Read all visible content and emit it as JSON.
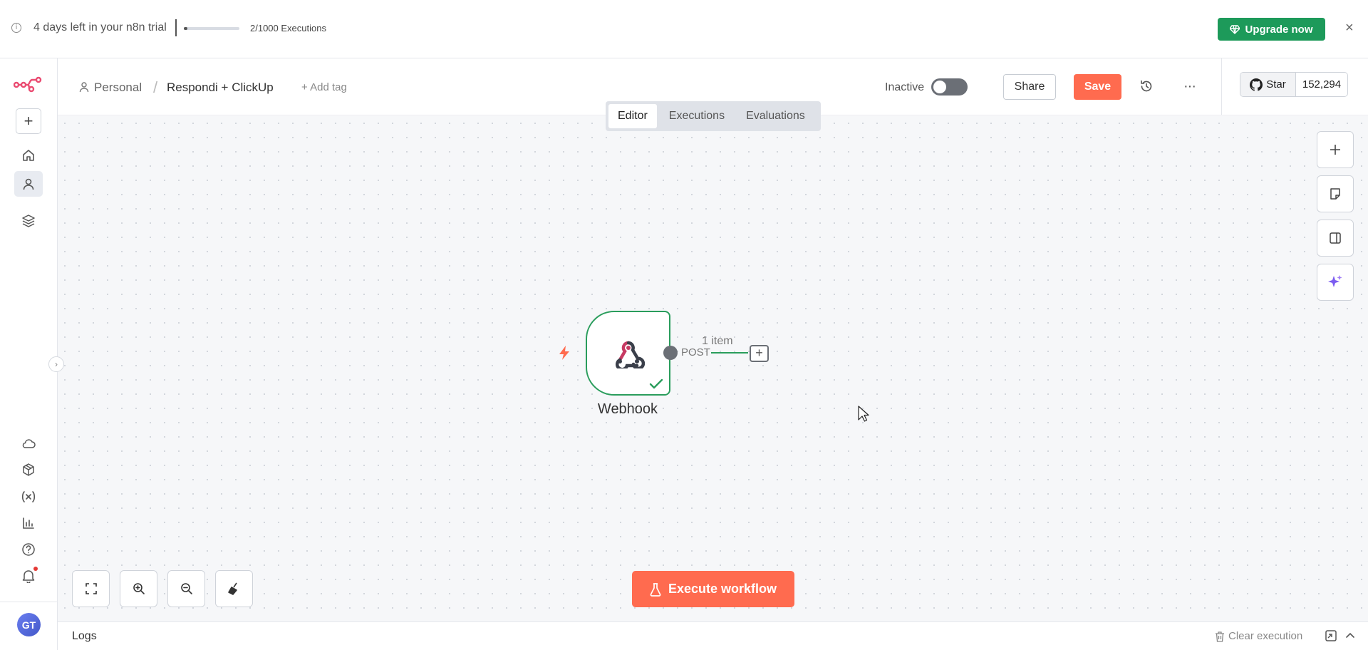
{
  "banner": {
    "trial_text": "4 days left in your n8n trial",
    "executions_text": "2/1000 Executions",
    "executions_used": 2,
    "executions_limit": 1000,
    "upgrade_label": "Upgrade now",
    "close_label": "×"
  },
  "header": {
    "breadcrumb_project": "Personal",
    "breadcrumb_separator": "/",
    "workflow_name": "Respondi + ClickUp",
    "add_tag_label": "+ Add tag",
    "active_label": "Inactive",
    "active": false,
    "share_label": "Share",
    "save_label": "Save",
    "more_label": "···",
    "github_star_label": "Star",
    "github_star_count": "152,294"
  },
  "tabs": [
    {
      "label": "Editor",
      "active": true
    },
    {
      "label": "Executions",
      "active": false
    },
    {
      "label": "Evaluations",
      "active": false
    }
  ],
  "sidebar": {
    "avatar_initials": "GT",
    "top_items": [
      "home-icon",
      "user-icon",
      "layers-icon"
    ],
    "bottom_items": [
      "cloud-icon",
      "package-icon",
      "variables-icon",
      "insights-icon",
      "help-icon",
      "bell-icon"
    ]
  },
  "canvas": {
    "node": {
      "name": "Webhook",
      "status": "success"
    },
    "output": {
      "branch_label": "POST",
      "items_label": "1 item"
    },
    "execute_label": "Execute workflow"
  },
  "logs": {
    "title": "Logs",
    "clear_label": "Clear execution"
  },
  "colors": {
    "brand_orange": "#ff6b4f",
    "upgrade_green": "#1d9a5a",
    "node_success": "#2a9d5c",
    "logo_pink": "#ea4b71"
  }
}
